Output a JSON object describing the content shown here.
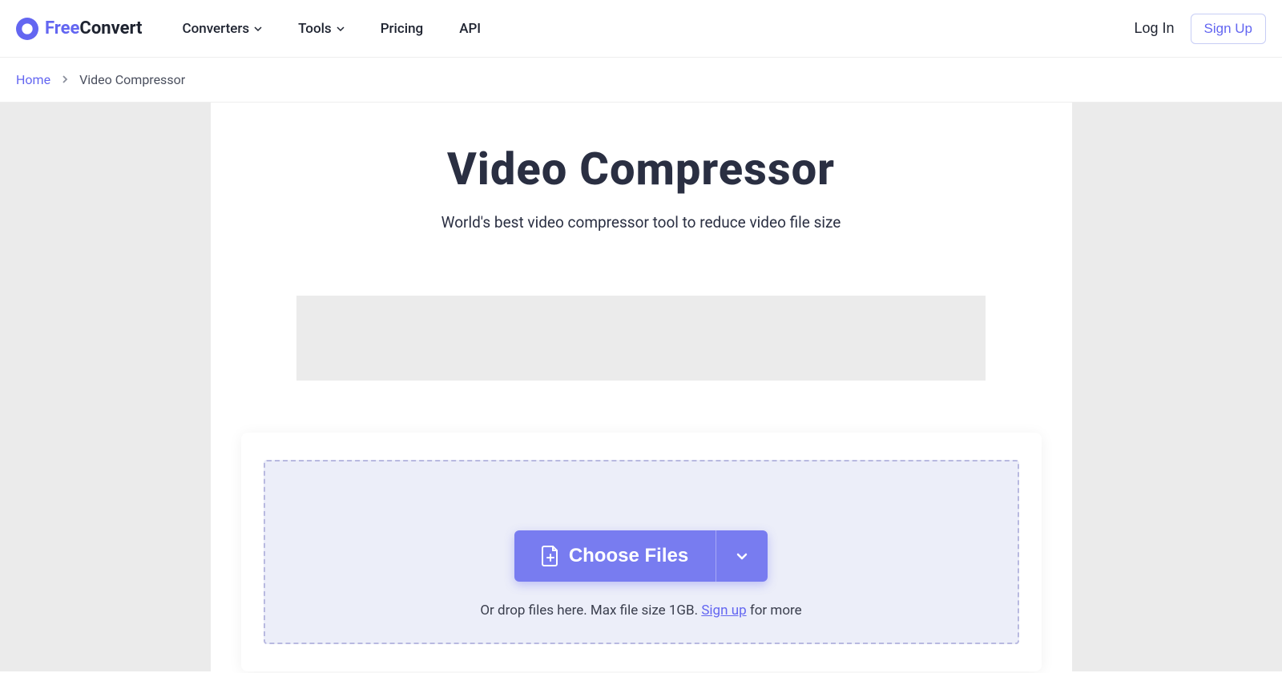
{
  "header": {
    "logo": {
      "free": "Free",
      "convert": "Convert"
    },
    "nav": {
      "converters": "Converters",
      "tools": "Tools",
      "pricing": "Pricing",
      "api": "API"
    },
    "login": "Log In",
    "signup": "Sign Up"
  },
  "breadcrumb": {
    "home": "Home",
    "current": "Video Compressor"
  },
  "page": {
    "title": "Video Compressor",
    "subtitle": "World's best video compressor tool to reduce video file size"
  },
  "upload": {
    "choose": "Choose Files",
    "drop_prefix": "Or drop files here. Max file size 1GB. ",
    "signup_link": "Sign up",
    "drop_suffix": " for more"
  }
}
